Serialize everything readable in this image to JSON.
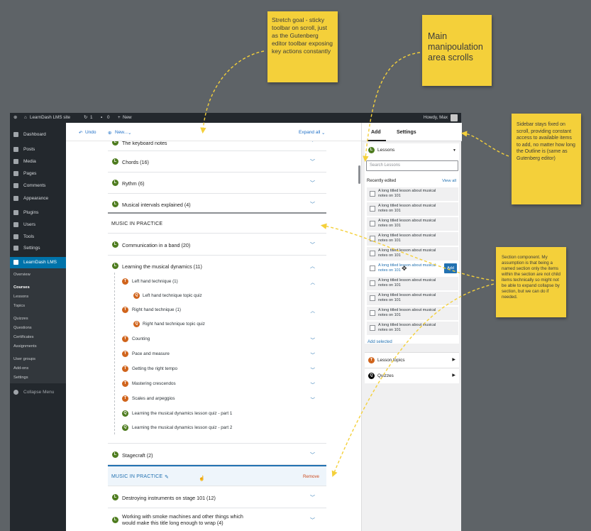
{
  "notes": {
    "sticky_toolbar": "Stretch goal - sticky toolbar on scroll, just as the Gutenberg editor toolbar exposing key actions constantly",
    "main_area": "Main manipoulation area scrolls",
    "sidebar_fixed": "Sidebar stays fixed on scroll, providing constant access to available items to add, no matter how long the Outline is (same as Gutenberg editor)",
    "section_component": "Section component. My assumption is that being a named section only the items within the section are not child items technically so might not be able to expand collapse by section, but we can do if needed."
  },
  "adminbar": {
    "site": "LearnDash LMS site",
    "updates": "1",
    "comments": "0",
    "new": "New",
    "howdy": "Howdy, Max"
  },
  "wpmenu": {
    "dashboard": "Dashboard",
    "posts": "Posts",
    "media": "Media",
    "pages": "Pages",
    "comments": "Comments",
    "appearance": "Appearance",
    "plugins": "Plugins",
    "users": "Users",
    "tools": "Tools",
    "settings": "Settings",
    "learndash": "LearnDash LMS",
    "sub": [
      "Overview",
      "Courses",
      "Lessons",
      "Topics",
      "Quizzes",
      "Questions",
      "Certificates",
      "Assignments",
      "User groups",
      "Add-ons",
      "Settings"
    ],
    "collapse": "Collapse Menu"
  },
  "toolbar": {
    "undo": "Undo",
    "new": "New...",
    "expand_all": "Expand all"
  },
  "outline": {
    "rows": [
      "The keyboard notes",
      "Chords (16)",
      "Rythm (6)",
      "Musical intervals explained (4)"
    ],
    "section1": "MUSIC IN PRACTICE",
    "row_comm": "Communication in a band (20)",
    "row_dyn": "Learning the musical dynamics (11)",
    "children": [
      "Left hand technique (1)",
      "Left hand technique topic quiz",
      "Right hand technique (1)",
      "Right hand technique topic quiz",
      "Counting",
      "Pace and measure",
      "Getting the right tempo",
      "Mastering crescendos",
      "Scales and arpeggios",
      "Learning the musical dynamics lesson quiz - part 1",
      "Learning the musical dynamics lesson quiz - part 2"
    ],
    "row_stage": "Stagecraft (2)",
    "section2": "MUSIC IN PRACTICE",
    "remove": "Remove",
    "row_destroy": "Destroying instruments on stage 101 (12)",
    "row_smoke_1": "Working with smoke machines and other things which",
    "row_smoke_2": "would make this title long enough to wrap (4)"
  },
  "sidebar": {
    "tab_add": "Add",
    "tab_settings": "Settings",
    "lessons_header": "Lessons",
    "search_placeholder": "Search Lessons",
    "recently_edited": "Recently edited",
    "view_all": "View all",
    "item_title": "A long titled lesson about musical notes on 101",
    "add_button": "Add",
    "add_selected": "Add selected",
    "lesson_topics": "Lesson topics",
    "quizzes": "Quizzes"
  },
  "badges": {
    "lesson": "L",
    "topic": "T",
    "quiz": "Q"
  },
  "colors": {
    "accent": "#2271b1",
    "lesson": "#4e7c1f",
    "topic": "#d0641c",
    "note": "#f4d03a",
    "remove": "#cc4b1f"
  }
}
